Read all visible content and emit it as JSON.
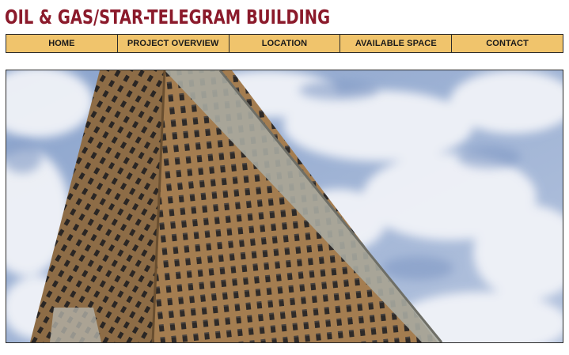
{
  "site": {
    "title": "OIL & GAS/STAR-TELEGRAM BUILDING"
  },
  "nav": {
    "items": [
      {
        "id": "home",
        "label": "HOME"
      },
      {
        "id": "project-overview",
        "label": "PROJECT OVERVIEW"
      },
      {
        "id": "location",
        "label": "LOCATION"
      },
      {
        "id": "available-space",
        "label": "AVAILABLE SPACE"
      },
      {
        "id": "contact",
        "label": "CONTACT"
      }
    ]
  },
  "hero": {
    "subject": "Oil & Gas / Star-Telegram Building tower photographed from below against a cloudy sky",
    "colors": {
      "sky": "#9fb4d6",
      "cloud": "#eef1f7",
      "brick": "#a07a4e",
      "stone": "#a9a9a0"
    }
  },
  "theme": {
    "title_color": "#8b1a2b",
    "nav_bg": "#f0c46c",
    "border": "#2b2b2b"
  }
}
